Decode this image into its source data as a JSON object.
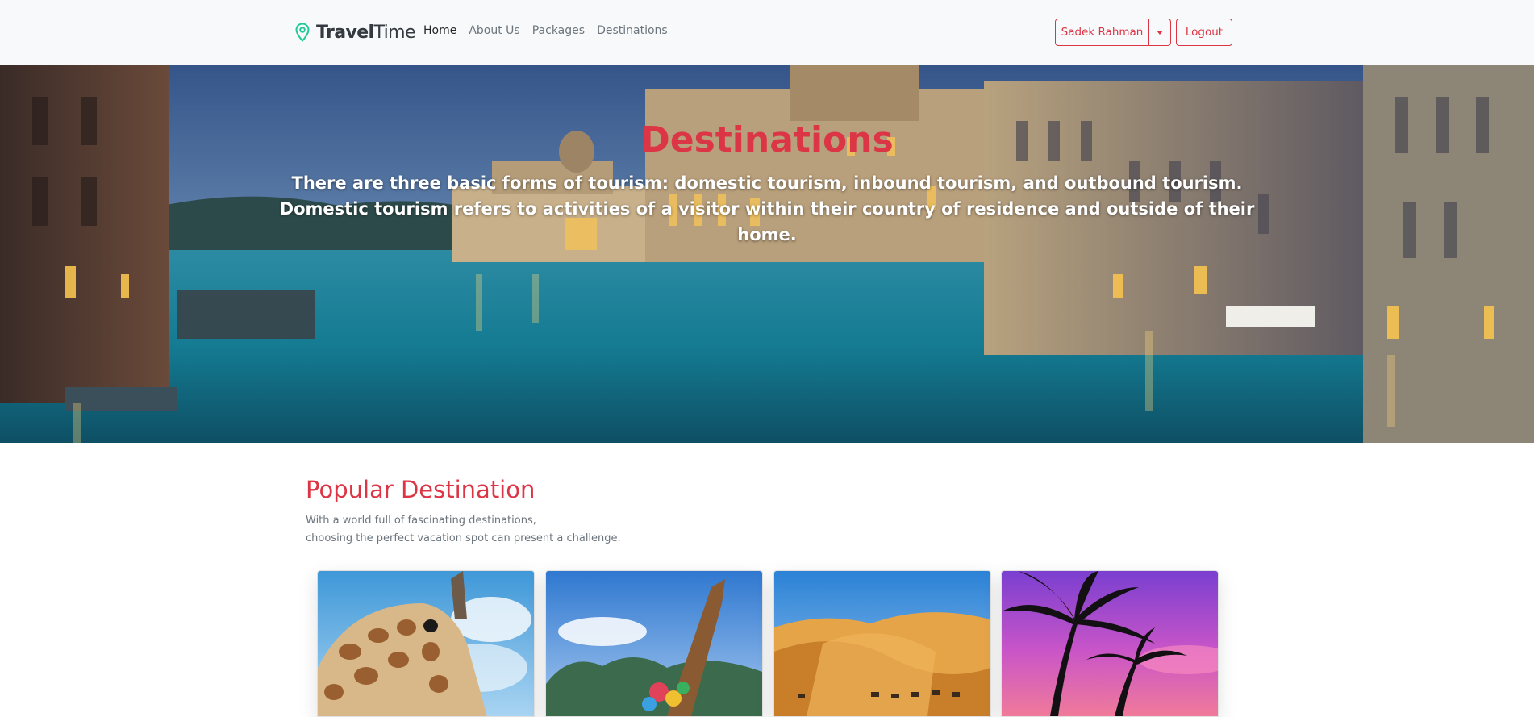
{
  "navbar": {
    "brand": {
      "bold": "Travel",
      "light": "Time",
      "icon": "map-pin-icon"
    },
    "links": [
      {
        "label": "Home",
        "active": true
      },
      {
        "label": "About Us",
        "active": false
      },
      {
        "label": "Packages",
        "active": false
      },
      {
        "label": "Destinations",
        "active": false
      }
    ],
    "user_button": "Sadek Rahman",
    "logout_button": "Logout"
  },
  "hero": {
    "title": "Destinations",
    "line1": "There are three basic forms of tourism: domestic tourism, inbound tourism, and outbound tourism.",
    "line2": "Domestic tourism refers to activities of a visitor within their country of residence and outside of their home."
  },
  "popular": {
    "title": "Popular Destination",
    "subtitle_line1": "With a world full of fascinating destinations,",
    "subtitle_line2": "choosing the perfect vacation spot can present a challenge."
  },
  "colors": {
    "accent": "#dc3545",
    "navbar_bg": "#f8f9fa",
    "brand_icon": "#20c997"
  }
}
